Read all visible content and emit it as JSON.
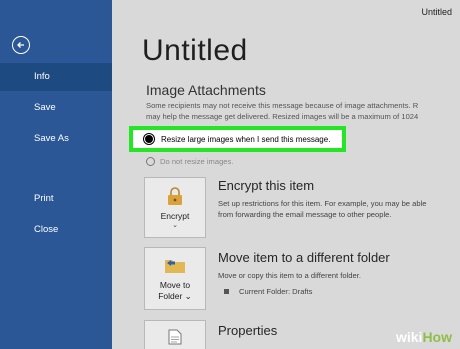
{
  "sidebar": {
    "items": [
      {
        "label": "Info",
        "active": true
      },
      {
        "label": "Save"
      },
      {
        "label": "Save As"
      },
      {
        "label": "Print"
      },
      {
        "label": "Close"
      }
    ]
  },
  "window": {
    "title": "Untitled"
  },
  "main": {
    "title": "Untitled",
    "image_attachments": {
      "heading": "Image Attachments",
      "desc_line1": "Some recipients may not receive this message because of image attachments. R",
      "desc_line2": "may help the message get delivered. Resized images will be a maximum of 1024",
      "option_selected": "Resize large images when I send this message.",
      "option_other": "Do not resize images."
    },
    "encrypt": {
      "button_label": "Encrypt",
      "title": "Encrypt this item",
      "desc_line1": "Set up restrictions for this item. For example, you may be able",
      "desc_line2": "from forwarding the email message to other people."
    },
    "move": {
      "button_label_1": "Move to",
      "button_label_2": "Folder",
      "title": "Move item to a different folder",
      "desc": "Move or copy this item to a different folder.",
      "current_folder": "Current Folder:   Drafts"
    },
    "properties": {
      "title": "Properties"
    }
  },
  "watermark": {
    "wiki": "wiki",
    "how": "How"
  },
  "colors": {
    "sidebar": "#2b5797",
    "highlight": "#24e624"
  }
}
